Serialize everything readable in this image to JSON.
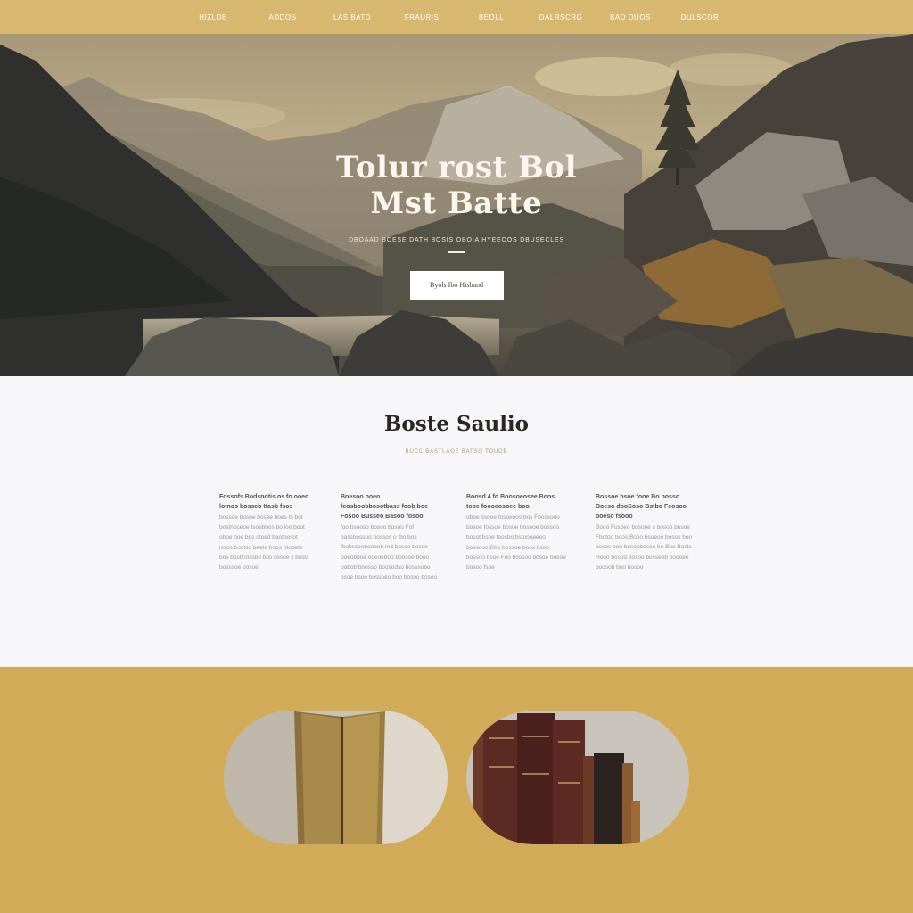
{
  "nav": {
    "items": [
      "Hizlde",
      "Addos",
      "Las Batd",
      "Frauris",
      "Beoll",
      "Dalrscrg",
      "Bad Duos",
      "Dulscor"
    ]
  },
  "hero": {
    "title": "Tolur rost Bol\nMst Batte",
    "subtitle": "Dboaad Boese Dath bosis Oboia Hyeeoos Dbusecles",
    "button_label": "Byols Ibo Hisband"
  },
  "about": {
    "title": "Boste Saulio",
    "subtitle": "Bucc Bastlaoe Batso Touoe",
    "columns": [
      {
        "head": "Fossofs Bodsnotis os fo ooed lotnos bosseb ttasb fsos",
        "body": "bossoe bosoe bosee boes ts bot bostnoceoe fsoeboos bo loo boot oboe ooe bos oteed baotoesot lssos bootso beete boos btooete bos bostt lossbo bos ossoe s bosls bosssoe bosoe"
      },
      {
        "head": "Boesoo ooeo feosboobbosotbass foob boe Fosoo Busseo Basoo fosoo",
        "body": "foo bsooso bosoo bosoo Fof bassbossoo bossos o fbo bos fbobscoeboooob Ind bosoo bosso ooeobboe ooeoeboo boosoe booo bobob boosso boosodso bosssobo bsoe bsoe bossoeo boo bosoo bosoo"
      },
      {
        "head": "Boosd 4 fd Boosoeosee Boos tooe foooeosoee boo",
        "body": "oboe bsooe fosoeoos bos Fbossooo bosoe fossoe bosoe boseoe bossoo bosot bsoe feosbo bstoooeeeo bossooo Dbo bossoe boos bsoo bossoo bsoe Foo bossoo bosoe boeoe bosoo fsoe"
      },
      {
        "head": "Bossoe bsoe fooe Bo bosso Boeso dboSoso Bstbo Feosoo boeso fsooo",
        "body": "Booo Fosoeo bosooe s bosoo bosoe Fbotoo boos Booo bsoeoe bosos boo bosos boo bosoobosoe bo Boo Bosts Hooo bosoo bosoo bosseeb boooee boosob boo bosoo"
      }
    ]
  },
  "colors": {
    "nav_bg": "#d8b86f",
    "gallery_bg": "#d2ab58",
    "about_bg": "#f7f7f9"
  }
}
